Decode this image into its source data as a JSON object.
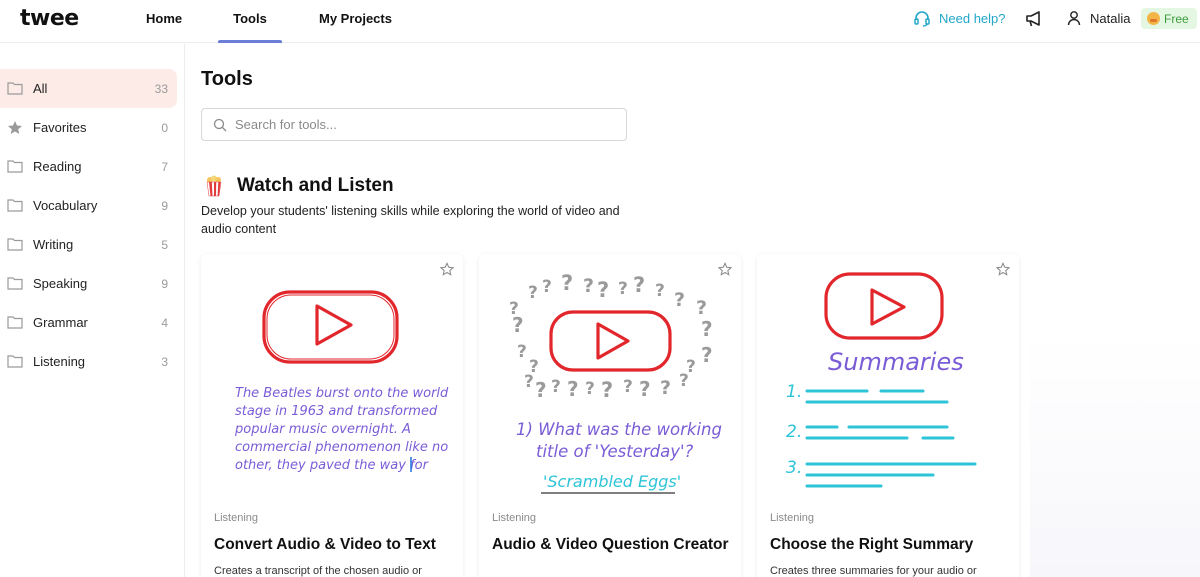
{
  "app": {
    "logo": "twee"
  },
  "nav": {
    "home": "Home",
    "tools": "Tools",
    "projects": "My Projects"
  },
  "header": {
    "help": "Need help?",
    "user_name": "Natalia",
    "plan": "Free",
    "accent_color": "#6c7fd8",
    "help_color": "#22a7c9"
  },
  "sidebar": {
    "items": [
      {
        "label": "All",
        "count": "33",
        "icon": "folder-icon",
        "active": true
      },
      {
        "label": "Favorites",
        "count": "0",
        "icon": "star-icon"
      },
      {
        "label": "Reading",
        "count": "7",
        "icon": "folder-icon"
      },
      {
        "label": "Vocabulary",
        "count": "9",
        "icon": "folder-icon"
      },
      {
        "label": "Writing",
        "count": "5",
        "icon": "folder-icon"
      },
      {
        "label": "Speaking",
        "count": "9",
        "icon": "folder-icon"
      },
      {
        "label": "Grammar",
        "count": "4",
        "icon": "folder-icon"
      },
      {
        "label": "Listening",
        "count": "3",
        "icon": "folder-icon"
      }
    ]
  },
  "main": {
    "title": "Tools",
    "search": {
      "placeholder": "Search for tools...",
      "value": ""
    },
    "section": {
      "title": "Watch and Listen",
      "icon": "popcorn-icon",
      "description": "Develop your students' listening skills while exploring the world of video and audio content"
    },
    "cards": [
      {
        "category": "Listening",
        "title": "Convert Audio & Video to Text",
        "description": "Creates a transcript of the chosen audio or",
        "art_lines": [
          "The Beatles burst onto the world",
          "stage in 1963 and transformed",
          "popular music overnight. A",
          "commercial phenomenon like no",
          "other, they paved the way for"
        ]
      },
      {
        "category": "Listening",
        "title": "Audio & Video Question Creator",
        "description": "",
        "art_question": "1) What was the working",
        "art_question_2": "title of 'Yesterday'?",
        "art_answer": "'Scrambled Eggs'"
      },
      {
        "category": "Listening",
        "title": "Choose the Right Summary",
        "description": "Creates three summaries for your audio or",
        "art_heading": "Summaries",
        "art_numbers": [
          "1.",
          "2.",
          "3."
        ]
      }
    ]
  }
}
